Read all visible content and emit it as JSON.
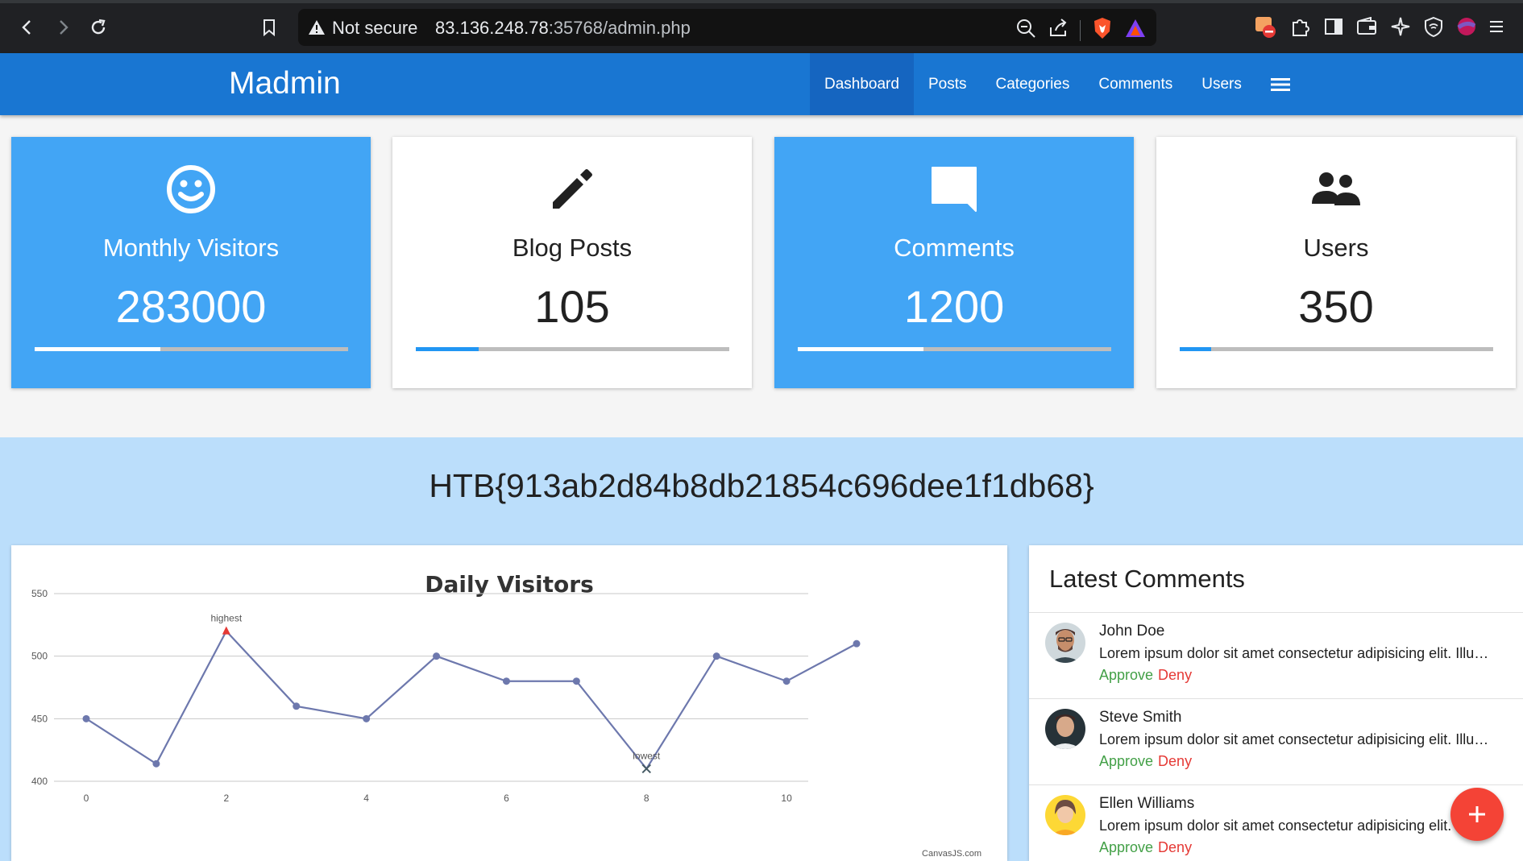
{
  "browser": {
    "security_label": "Not secure",
    "url_host": "83.136.248.78",
    "url_rest": ":35768/admin.php"
  },
  "app": {
    "brand": "Madmin",
    "menu": [
      {
        "label": "Dashboard",
        "active": true
      },
      {
        "label": "Posts"
      },
      {
        "label": "Categories"
      },
      {
        "label": "Comments"
      },
      {
        "label": "Users"
      }
    ]
  },
  "stats": [
    {
      "label": "Monthly Visitors",
      "value": "283000",
      "icon": "smiley-icon",
      "style": "blue",
      "progress": 0.4
    },
    {
      "label": "Blog Posts",
      "value": "105",
      "icon": "pencil-icon",
      "style": "white",
      "progress": 0.2
    },
    {
      "label": "Comments",
      "value": "1200",
      "icon": "comment-icon",
      "style": "blue",
      "progress": 0.4
    },
    {
      "label": "Users",
      "value": "350",
      "icon": "users-icon",
      "style": "white",
      "progress": 0.1
    }
  ],
  "flag": "HTB{913ab2d84b8db21854c696dee1f1db68}",
  "chart_data": {
    "type": "line",
    "title": "Daily Visitors",
    "x": [
      0,
      1,
      2,
      3,
      4,
      5,
      6,
      7,
      8,
      9,
      10,
      11
    ],
    "y": [
      450,
      414,
      520,
      460,
      450,
      500,
      480,
      480,
      410,
      500,
      480,
      510
    ],
    "ylim": [
      400,
      550
    ],
    "yticks": [
      400,
      450,
      500,
      550
    ],
    "xticks": [
      0,
      2,
      4,
      6,
      8,
      10
    ],
    "annotations": [
      {
        "x": 2,
        "label": "highest",
        "marker": "triangle",
        "color": "#e53935"
      },
      {
        "x": 8,
        "label": "lowest",
        "marker": "cross",
        "color": "#455a64"
      }
    ],
    "credit": "CanvasJS.com",
    "line_color": "#6d78ad",
    "grid": true
  },
  "comments": {
    "title": "Latest Comments",
    "items": [
      {
        "name": "John Doe",
        "text": "Lorem ipsum dolor sit amet consectetur adipisicing elit. Illum, quis.",
        "approve": "Approve",
        "deny": "Deny"
      },
      {
        "name": "Steve Smith",
        "text": "Lorem ipsum dolor sit amet consectetur adipisicing elit. Illum, quis.",
        "approve": "Approve",
        "deny": "Deny"
      },
      {
        "name": "Ellen Williams",
        "text": "Lorem ipsum dolor sit amet consectetur adipisicing elit. Illum, quis.",
        "approve": "Approve",
        "deny": "Deny"
      }
    ]
  },
  "fab_icon": "plus-icon"
}
